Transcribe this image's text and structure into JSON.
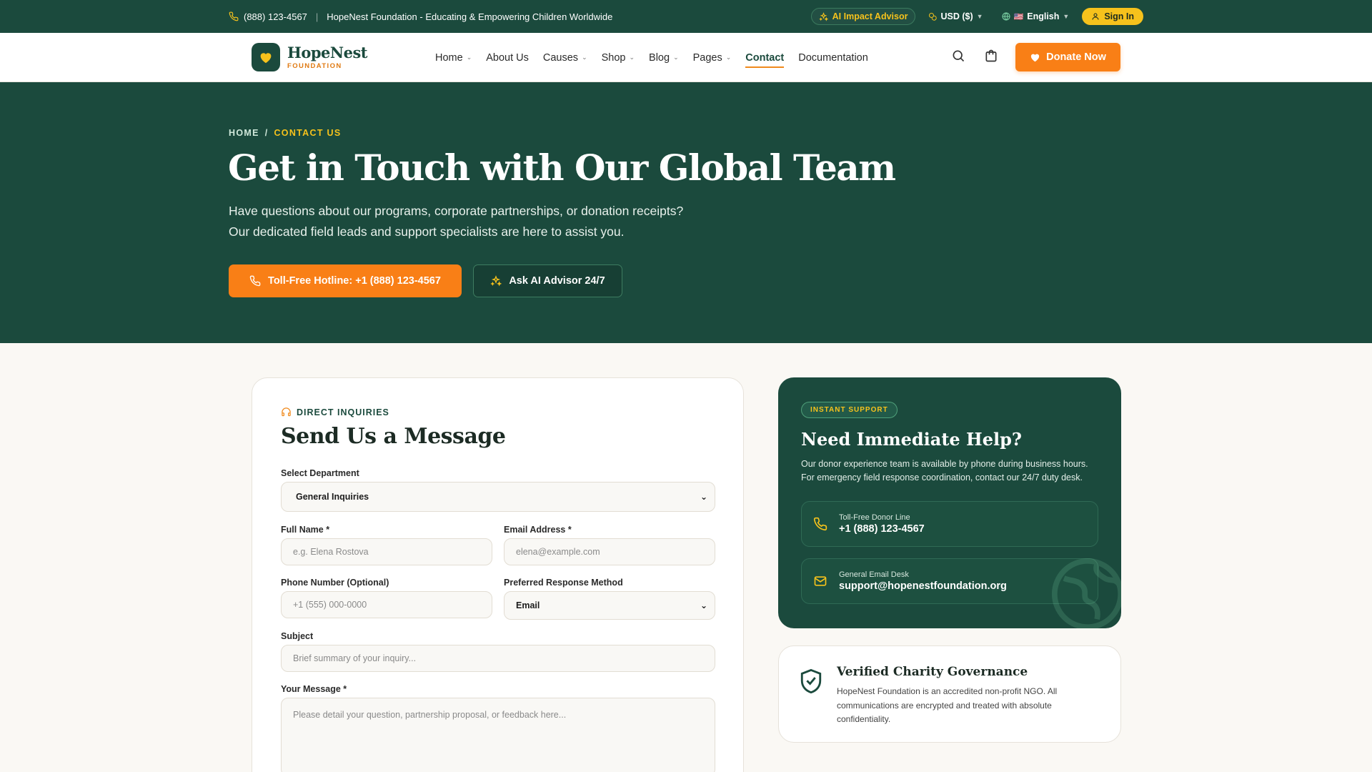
{
  "topbar": {
    "phone": "(888) 123-4567",
    "tagline": "HopeNest Foundation - Educating & Empowering Children Worldwide",
    "ai_advisor": "AI Impact Advisor",
    "currency": "USD ($)",
    "language_flag": "🇺🇸",
    "language": "English",
    "sign_in": "Sign In"
  },
  "header": {
    "logo_name": "HopeNest",
    "logo_sub": "FOUNDATION",
    "nav": [
      {
        "label": "Home",
        "dropdown": true
      },
      {
        "label": "About Us",
        "dropdown": false
      },
      {
        "label": "Causes",
        "dropdown": true
      },
      {
        "label": "Shop",
        "dropdown": true
      },
      {
        "label": "Blog",
        "dropdown": true
      },
      {
        "label": "Pages",
        "dropdown": true
      },
      {
        "label": "Contact",
        "dropdown": false,
        "active": true
      },
      {
        "label": "Documentation",
        "dropdown": false
      }
    ],
    "donate": "Donate Now"
  },
  "hero": {
    "breadcrumb_home": "HOME",
    "breadcrumb_sep": "/",
    "breadcrumb_current": "CONTACT US",
    "title": "Get in Touch with Our Global Team",
    "lede_1": "Have questions about our programs, corporate partnerships, or donation receipts?",
    "lede_2": "Our dedicated field leads and support specialists are here to assist you.",
    "hotline_button": "Toll-Free Hotline: +1 (888) 123-4567",
    "ai_button": "Ask AI Advisor 24/7"
  },
  "form": {
    "eyebrow": "DIRECT INQUIRIES",
    "title": "Send Us a Message",
    "department_label": "Select Department",
    "department_value": "General Inquiries",
    "name_label": "Full Name *",
    "name_placeholder": "e.g. Elena Rostova",
    "email_label": "Email Address *",
    "email_placeholder": "elena@example.com",
    "phone_label": "Phone Number (Optional)",
    "phone_placeholder": "+1 (555) 000-0000",
    "response_label": "Preferred Response Method",
    "response_value": "Email",
    "subject_label": "Subject",
    "subject_placeholder": "Brief summary of your inquiry...",
    "message_label": "Your Message *",
    "message_placeholder": "Please detail your question, partnership proposal, or feedback here..."
  },
  "help": {
    "badge": "INSTANT SUPPORT",
    "title": "Need Immediate Help?",
    "desc": "Our donor experience team is available by phone during business hours. For emergency field response coordination, contact our 24/7 duty desk.",
    "phone_key": "Toll-Free Donor Line",
    "phone_value": "+1 (888) 123-4567",
    "email_key": "General Email Desk",
    "email_value": "support@hopenestfoundation.org"
  },
  "verified": {
    "title": "Verified Charity Governance",
    "text": "HopeNest Foundation is an accredited non-profit NGO. All communications are encrypted and treated with absolute confidentiality."
  },
  "colors": {
    "brand_green": "#1b4a3d",
    "accent_orange": "#f97f16",
    "accent_yellow": "#f6c21c"
  }
}
